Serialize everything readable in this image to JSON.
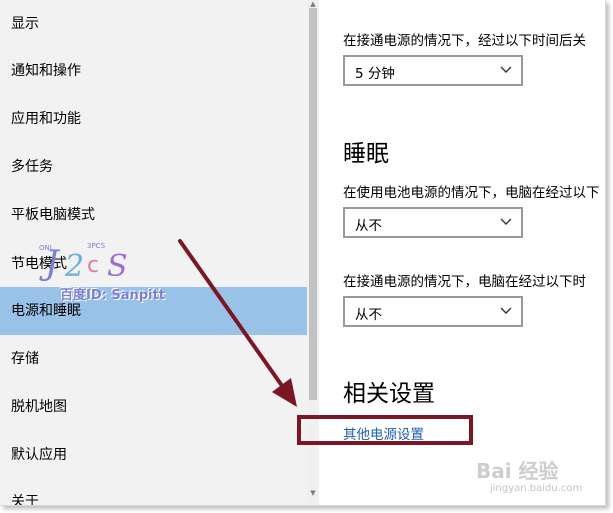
{
  "sidebar": {
    "items": [
      {
        "label": "显示"
      },
      {
        "label": "通知和操作"
      },
      {
        "label": "应用和功能"
      },
      {
        "label": "多任务"
      },
      {
        "label": "平板电脑模式"
      },
      {
        "label": "节电模式"
      },
      {
        "label": "电源和睡眠",
        "selected": true
      },
      {
        "label": "存储"
      },
      {
        "label": "脱机地图"
      },
      {
        "label": "默认应用"
      },
      {
        "label": "关于"
      }
    ]
  },
  "content": {
    "screen_plugged_label": "在接通电源的情况下，经过以下时间后关",
    "screen_plugged_value": "5 分钟",
    "sleep_heading": "睡眠",
    "sleep_battery_label": "在使用电池电源的情况下，电脑在经过以下",
    "sleep_battery_value": "从不",
    "sleep_plugged_label": "在接通电源的情况下，电脑在经过以下时",
    "sleep_plugged_value": "从不",
    "related_heading": "相关设置",
    "other_power_link": "其他电源设置"
  },
  "overlay": {
    "watermark_text": "百度ID: Sanpitt",
    "baidu_text": "Bai 经验",
    "baidu_url": "jingyan.baidu.com",
    "annotation_color": "#7b1624",
    "selected_color": "#99c2e8",
    "link_color": "#1a5fb4"
  }
}
